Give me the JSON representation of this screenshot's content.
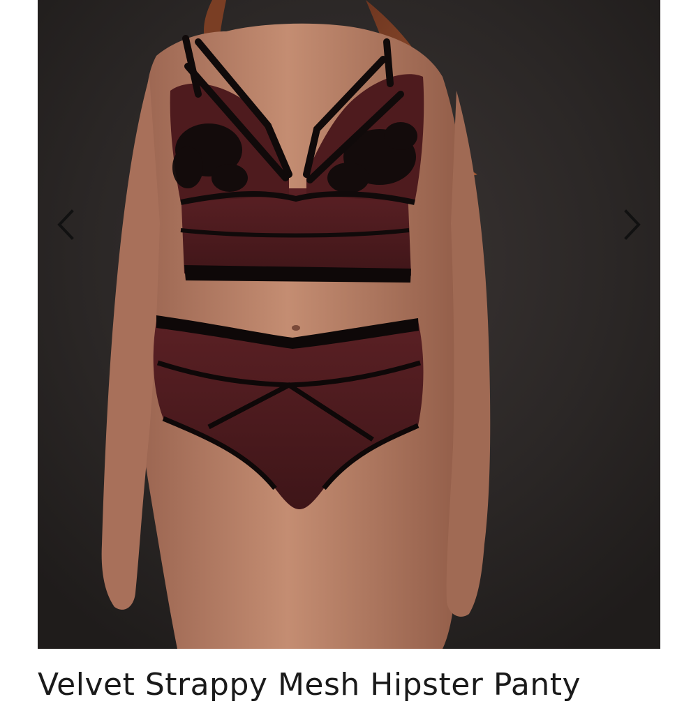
{
  "gallery": {
    "image_subject": "model wearing burgundy velvet strappy mesh lingerie set",
    "prev_icon": "chevron-left-icon",
    "next_icon": "chevron-right-icon",
    "arrow_color": "#111111"
  },
  "product": {
    "title": "Velvet Strappy Mesh Hipster Panty"
  },
  "colors": {
    "backdrop": "#2b2726",
    "garment": "#4a1a1c",
    "trim": "#120c0c",
    "skin": "#b57c62",
    "hair": "#8a4a2c"
  }
}
